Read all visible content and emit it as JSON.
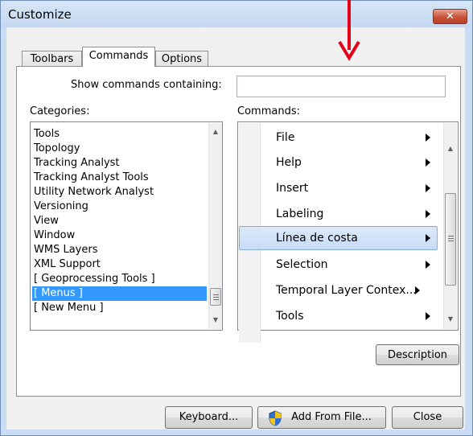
{
  "window": {
    "title": "Customize",
    "close_symbol": "✕"
  },
  "tabs": [
    {
      "label": "Toolbars",
      "selected": false
    },
    {
      "label": "Commands",
      "selected": true
    },
    {
      "label": "Options",
      "selected": false
    }
  ],
  "search": {
    "label": "Show commands containing:",
    "value": ""
  },
  "categories": {
    "label": "Categories:",
    "items": [
      "Tools",
      "Topology",
      "Tracking Analyst",
      "Tracking Analyst Tools",
      "Utility Network Analyst",
      "Versioning",
      "View",
      "Window",
      "WMS Layers",
      "XML Support",
      "[ Geoprocessing Tools ]",
      "[ Menus ]",
      "[ New Menu ]"
    ],
    "selected": "[ Menus ]"
  },
  "commands": {
    "label": "Commands:",
    "items": [
      "File",
      "Help",
      "Insert",
      "Labeling",
      "Línea de costa",
      "Selection",
      "Temporal Layer Contex...",
      "Tools"
    ],
    "selected": "Línea de costa"
  },
  "buttons": {
    "description": "Description",
    "keyboard": "Keyboard...",
    "add_from_file": "Add From File...",
    "close": "Close"
  },
  "annotation": {
    "arrow_color": "#e3001b"
  },
  "colors": {
    "selection": "#3399ff",
    "window_frame": "#c9dcf3"
  }
}
